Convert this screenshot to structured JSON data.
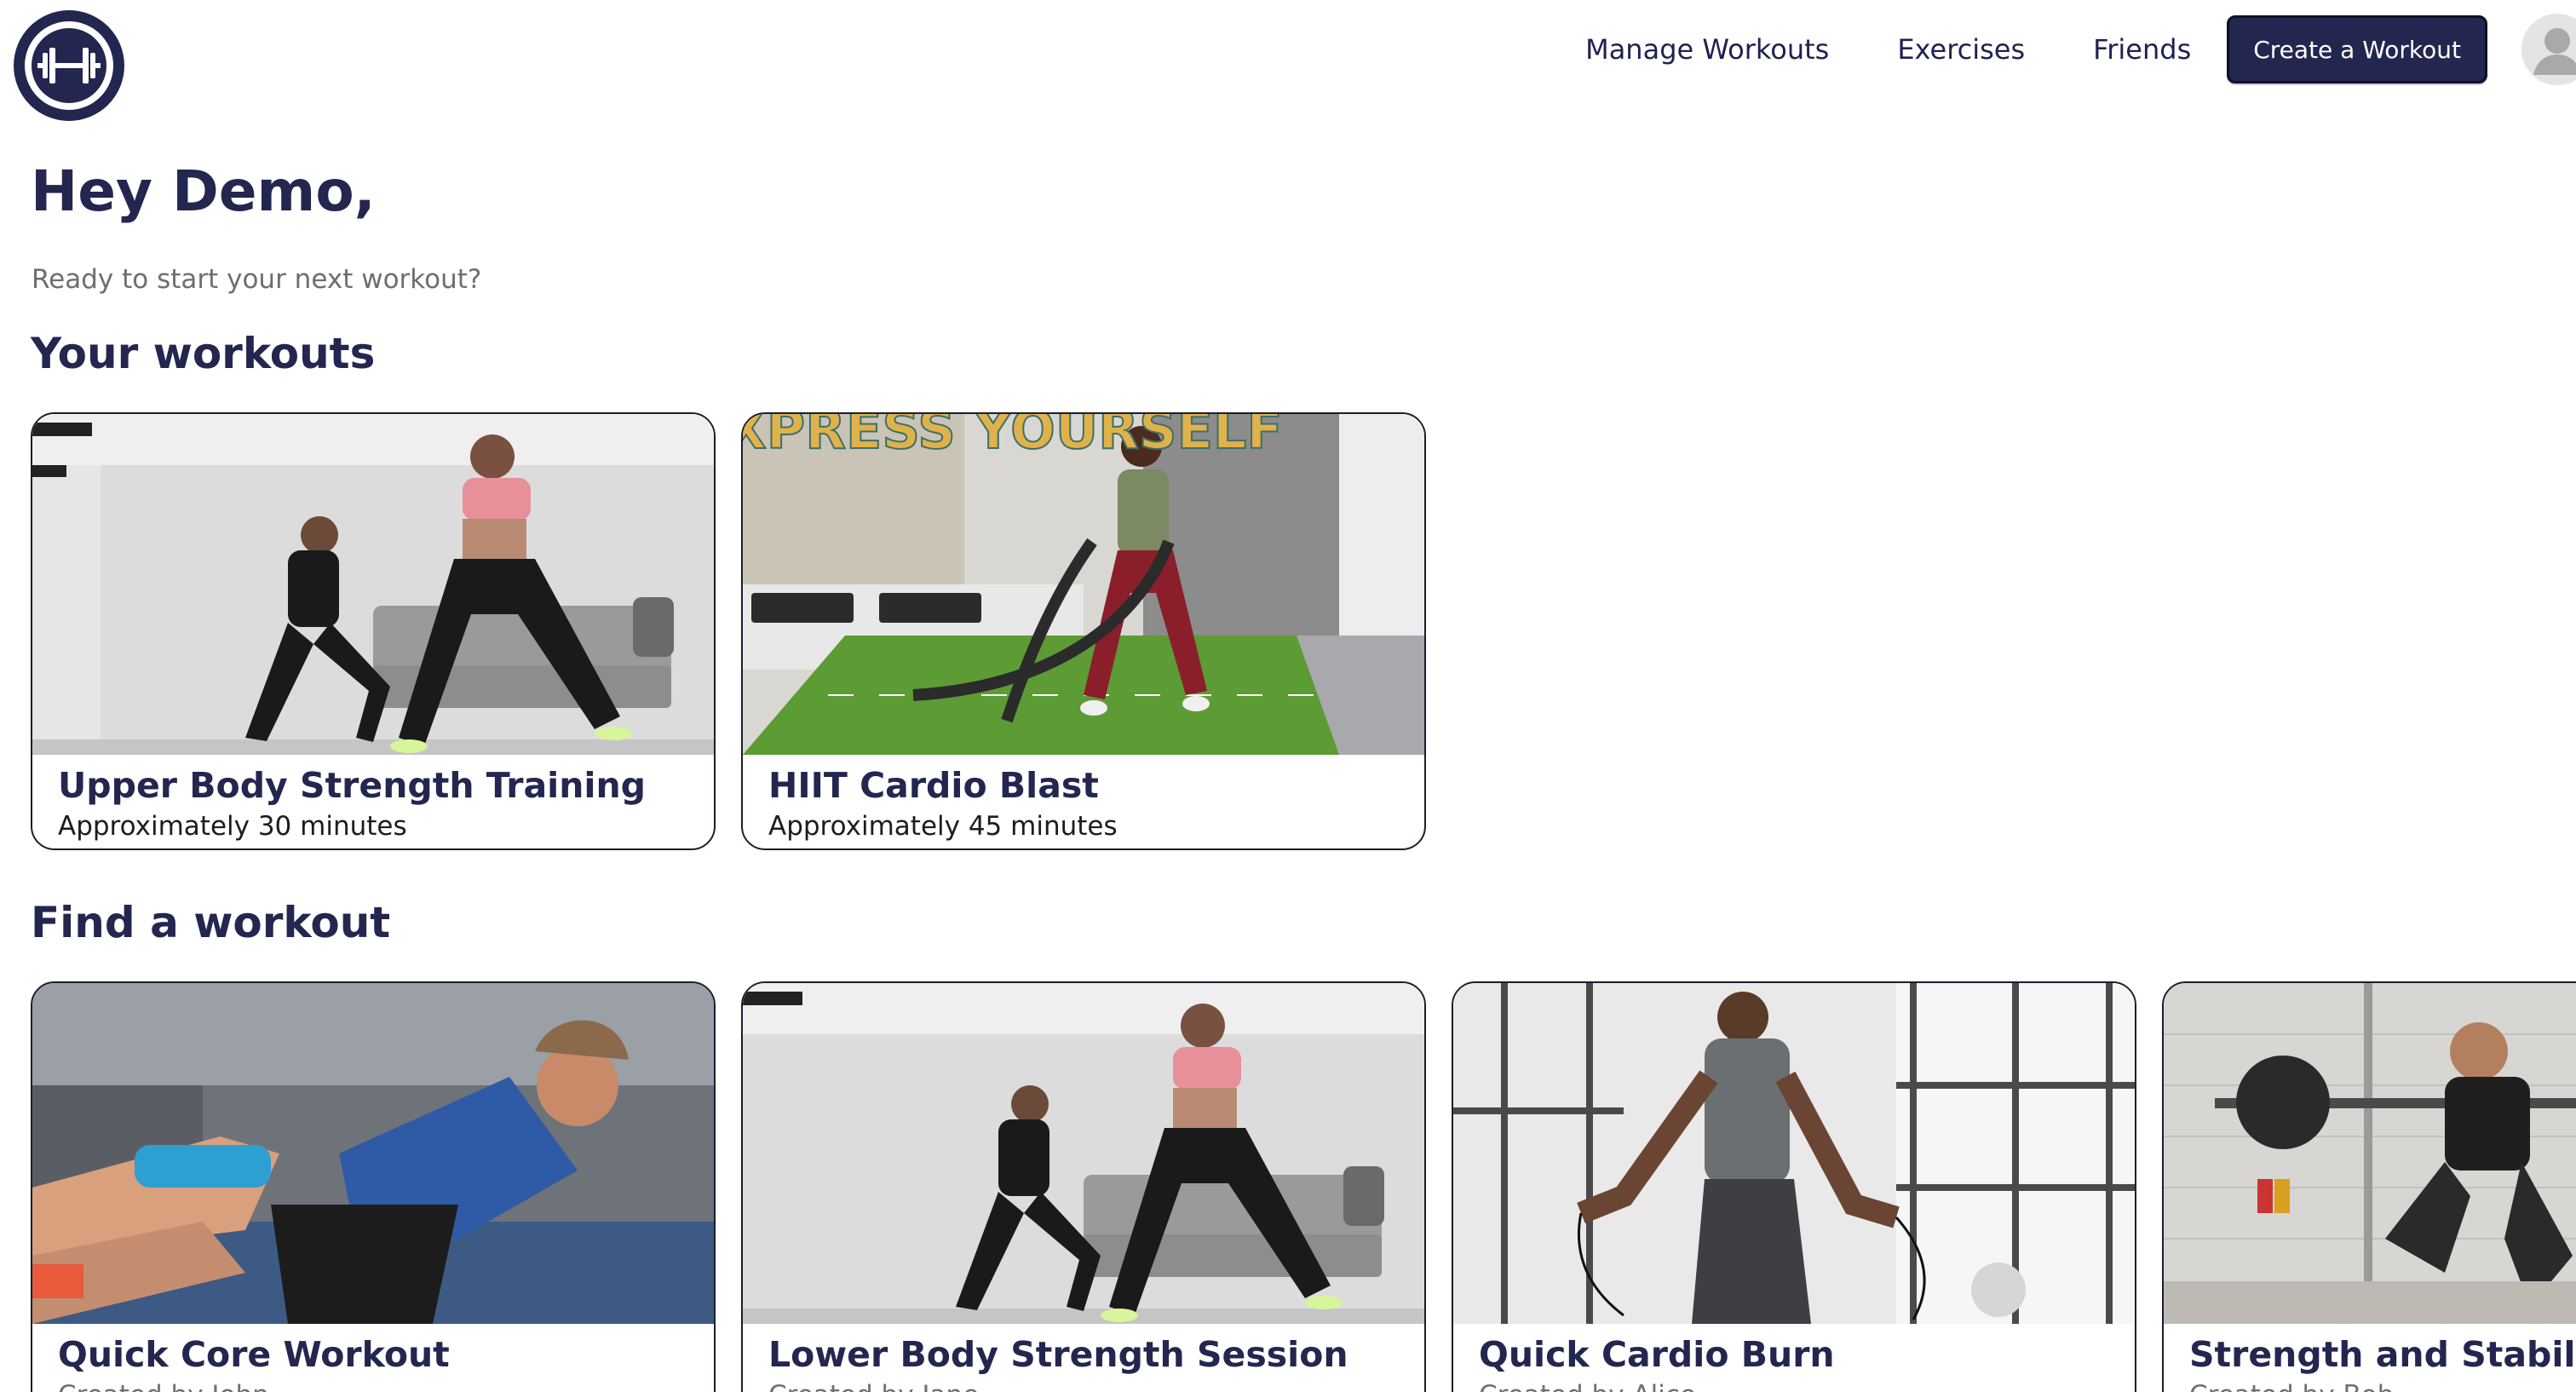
{
  "header": {
    "logo_icon": "dumbbell-icon",
    "nav": [
      {
        "label": "Manage Workouts"
      },
      {
        "label": "Exercises"
      },
      {
        "label": "Friends"
      }
    ],
    "create_button": "Create a Workout",
    "avatar_icon": "user-avatar-icon",
    "brand_color": "#23264f"
  },
  "greeting": {
    "title": "Hey Demo,",
    "subtitle": "Ready to start your next workout?"
  },
  "your_workouts": {
    "heading": "Your workouts",
    "cards": [
      {
        "title": "Upper Body Strength Training",
        "subtitle": "Approximately 30 minutes"
      },
      {
        "title": "HIIT Cardio Blast",
        "subtitle": "Approximately 45 minutes",
        "image_text": "XPRESS YOURSELF"
      }
    ]
  },
  "find_workout": {
    "heading": "Find a workout",
    "cards": [
      {
        "title": "Quick Core Workout",
        "subtitle": "Created by John"
      },
      {
        "title": "Lower Body Strength Session",
        "subtitle": "Created by Jane"
      },
      {
        "title": "Quick Cardio Burn",
        "subtitle": "Created by Alice"
      },
      {
        "title": "Strength and Stability W",
        "subtitle": "Created by Bob"
      }
    ]
  }
}
